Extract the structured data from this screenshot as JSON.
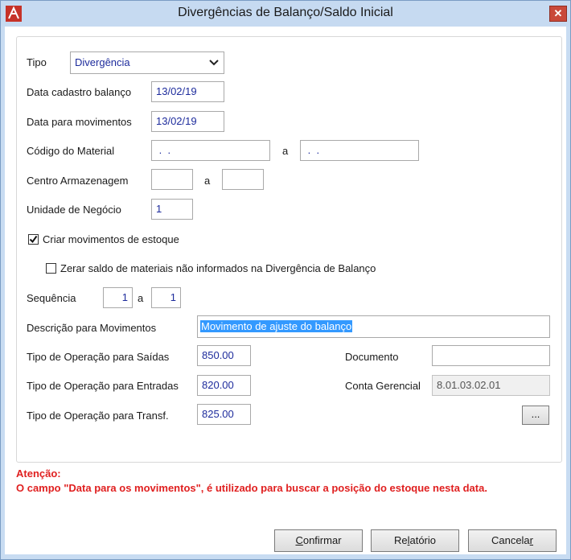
{
  "window": {
    "title": "Divergências de Balanço/Saldo Inicial",
    "close_glyph": "✕"
  },
  "form": {
    "tipo": {
      "label": "Tipo",
      "value": "Divergência"
    },
    "data_cadastro": {
      "label": "Data cadastro balanço",
      "value": "13/02/19"
    },
    "data_movimentos": {
      "label": "Data para movimentos",
      "value": "13/02/19"
    },
    "codigo_material": {
      "label": "Código do Material",
      "from": " .  .",
      "sep": "a",
      "to": " .  ."
    },
    "centro_armazenagem": {
      "label": "Centro Armazenagem",
      "from": "",
      "sep": "a",
      "to": ""
    },
    "unidade_negocio": {
      "label": "Unidade de Negócio",
      "value": "1"
    },
    "criar_movimentos": {
      "label": "Criar movimentos de estoque",
      "checked": true
    },
    "zerar_saldo": {
      "label": "Zerar saldo de materiais não informados na Divergência de Balanço",
      "checked": false
    },
    "sequencia": {
      "label": "Sequência",
      "from": "1",
      "sep": "a",
      "to": "1"
    },
    "descricao": {
      "label": "Descrição para Movimentos",
      "value": "Movimento de ajuste do balanço"
    },
    "op_saidas": {
      "label": "Tipo de Operação para Saídas",
      "value": "850.00"
    },
    "op_entradas": {
      "label": "Tipo de Operação para Entradas",
      "value": "820.00"
    },
    "op_transf": {
      "label": "Tipo de Operação para Transf.",
      "value": "825.00"
    },
    "documento": {
      "label": "Documento",
      "value": ""
    },
    "conta_gerencial": {
      "label": "Conta Gerencial",
      "value": "8.01.03.02.01"
    },
    "ellipsis_button": "..."
  },
  "warning": {
    "heading": "Atenção:",
    "text": "O campo \"Data para os movimentos\", é utilizado para buscar a posição do estoque nesta data."
  },
  "buttons": {
    "confirmar": {
      "accel": "C",
      "rest": "onfirmar"
    },
    "relatorio": {
      "pre": "Re",
      "accel": "l",
      "rest": "atório"
    },
    "cancelar": {
      "pre": "Cancela",
      "accel": "r",
      "rest": ""
    }
  },
  "colors": {
    "accent_text": "#1d2b9c",
    "warning": "#e02020",
    "selection": "#3399ff",
    "titlebar": "#c6daf1",
    "close": "#c9493a"
  }
}
